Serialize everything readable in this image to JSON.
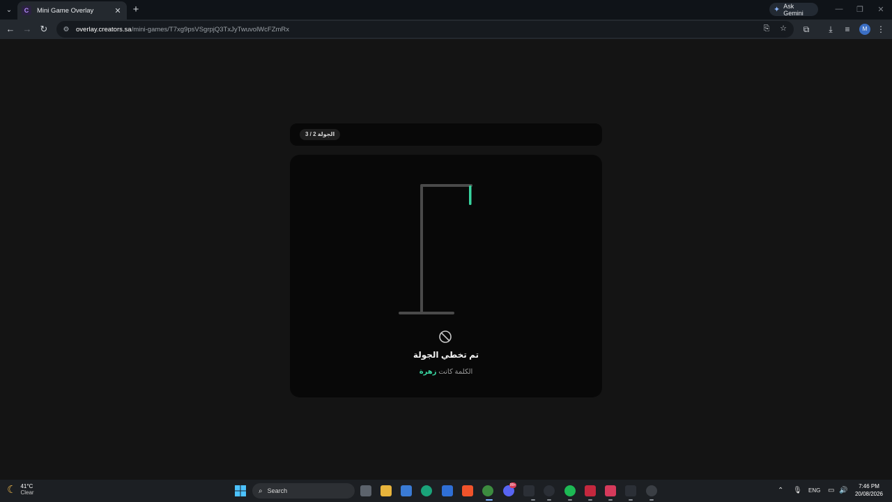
{
  "browser": {
    "tab": {
      "title": "Mini Game Overlay",
      "favicon_letter": "C"
    },
    "ask_gemini_label": "Ask Gemini",
    "url_host": "overlay.creators.sa",
    "url_path": "/mini-games/T7xg9psVSgrpjQ3TxJyTwuvolWcFZmRx",
    "profile_initial": "M"
  },
  "game": {
    "round_label": "الجولة 2 / 3",
    "status_title": "تم تخطي الجولة",
    "status_prefix": "الكلمة كانت",
    "status_word": "زهرة",
    "accent_color": "#38d39f"
  },
  "taskbar": {
    "weather_temp": "41°C",
    "weather_condition": "Clear",
    "search_label": "Search",
    "discord_badge": "99+",
    "lang": "ENG",
    "time": "7:46 PM",
    "date": "20/08/2026"
  }
}
